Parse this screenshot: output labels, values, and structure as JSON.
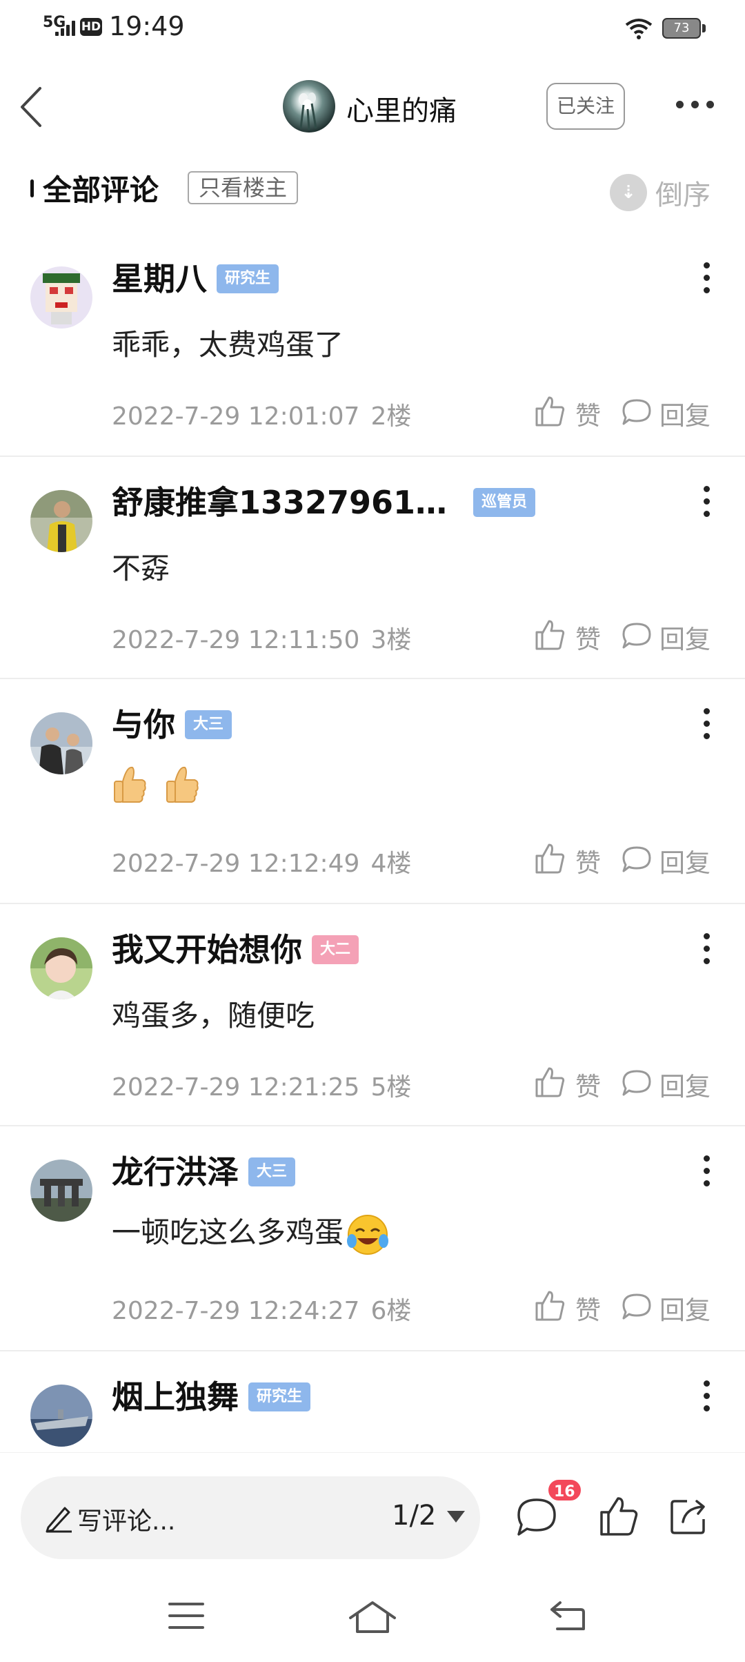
{
  "status_bar": {
    "network": "5G",
    "hd": "HD",
    "time": "19:49",
    "battery": "73"
  },
  "header": {
    "author_name": "心里的痛",
    "follow_label": "已关注"
  },
  "filter": {
    "title": "全部评论",
    "only_op_label": "只看楼主",
    "sort_label": "倒序"
  },
  "comments": [
    {
      "name": "星期八",
      "badge": "研究生",
      "text": "乖乖，太费鸡蛋了",
      "time": "2022-7-29 12:01:07",
      "floor": "2楼",
      "like": "赞",
      "reply": "回复"
    },
    {
      "name": "舒康推拿13327961…",
      "badge": "巡管员",
      "text": "不孬",
      "time": "2022-7-29 12:11:50",
      "floor": "3楼",
      "like": "赞",
      "reply": "回复"
    },
    {
      "name": "与你",
      "badge": "大三",
      "text": "",
      "time": "2022-7-29 12:12:49",
      "floor": "4楼",
      "like": "赞",
      "reply": "回复"
    },
    {
      "name": "我又开始想你",
      "badge": "大二",
      "text": "鸡蛋多，随便吃",
      "time": "2022-7-29 12:21:25",
      "floor": "5楼",
      "like": "赞",
      "reply": "回复"
    },
    {
      "name": "龙行洪泽",
      "badge": "大三",
      "text": "一顿吃这么多鸡蛋",
      "time": "2022-7-29 12:24:27",
      "floor": "6楼",
      "like": "赞",
      "reply": "回复"
    },
    {
      "name": "烟上独舞",
      "badge": "研究生",
      "text": "",
      "time": "",
      "floor": "",
      "like": "",
      "reply": ""
    }
  ],
  "bottom_bar": {
    "placeholder": "写评论...",
    "page_indicator": "1/2",
    "comment_count": "16"
  },
  "colors": {
    "badge_blue": "#8eb7ec",
    "badge_pink": "#f4a1b6",
    "count_red": "#f3485a"
  }
}
